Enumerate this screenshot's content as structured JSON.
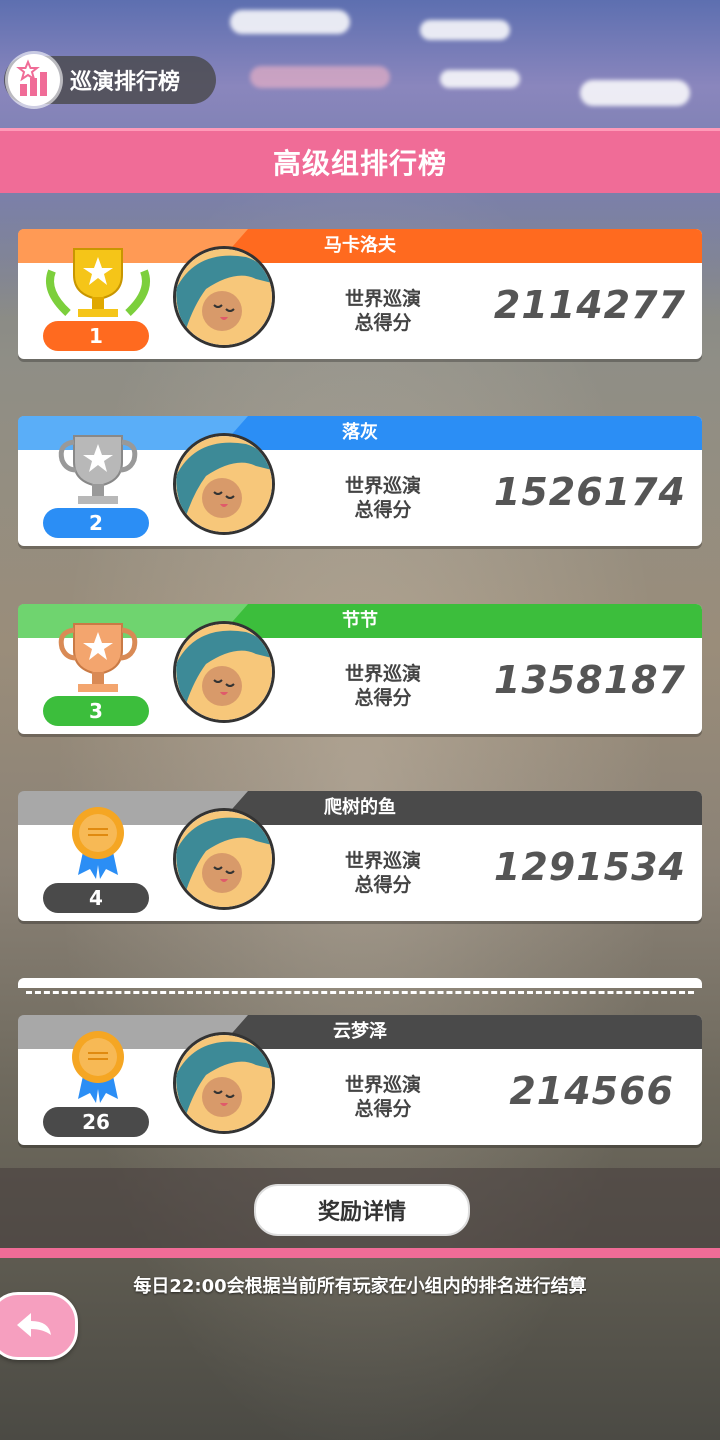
{
  "header": {
    "title": "巡演排行榜"
  },
  "banner": {
    "title": "高级组排行榜"
  },
  "score_label_line1": "世界巡演",
  "score_label_line2": "总得分",
  "entries": [
    {
      "rank": "1",
      "name": "马卡洛夫",
      "score": "2114277",
      "color": "#ff6a1f",
      "award": "gold-trophy"
    },
    {
      "rank": "2",
      "name": "落灰",
      "score": "1526174",
      "color": "#2b8ef5",
      "award": "silver-trophy"
    },
    {
      "rank": "3",
      "name": "节节",
      "score": "1358187",
      "color": "#3cbe3c",
      "award": "bronze-trophy"
    },
    {
      "rank": "4",
      "name": "爬树的鱼",
      "score": "1291534",
      "color": "#4a4a4a",
      "award": "ribbon-medal"
    }
  ],
  "self_entry": {
    "rank": "26",
    "name": "云梦泽",
    "score": "214566",
    "color": "#4a4a4a",
    "award": "ribbon-medal"
  },
  "buttons": {
    "reward_details": "奖励详情"
  },
  "footer": {
    "notice": "每日22:00会根据当前所有玩家在小组内的排名进行结算"
  }
}
